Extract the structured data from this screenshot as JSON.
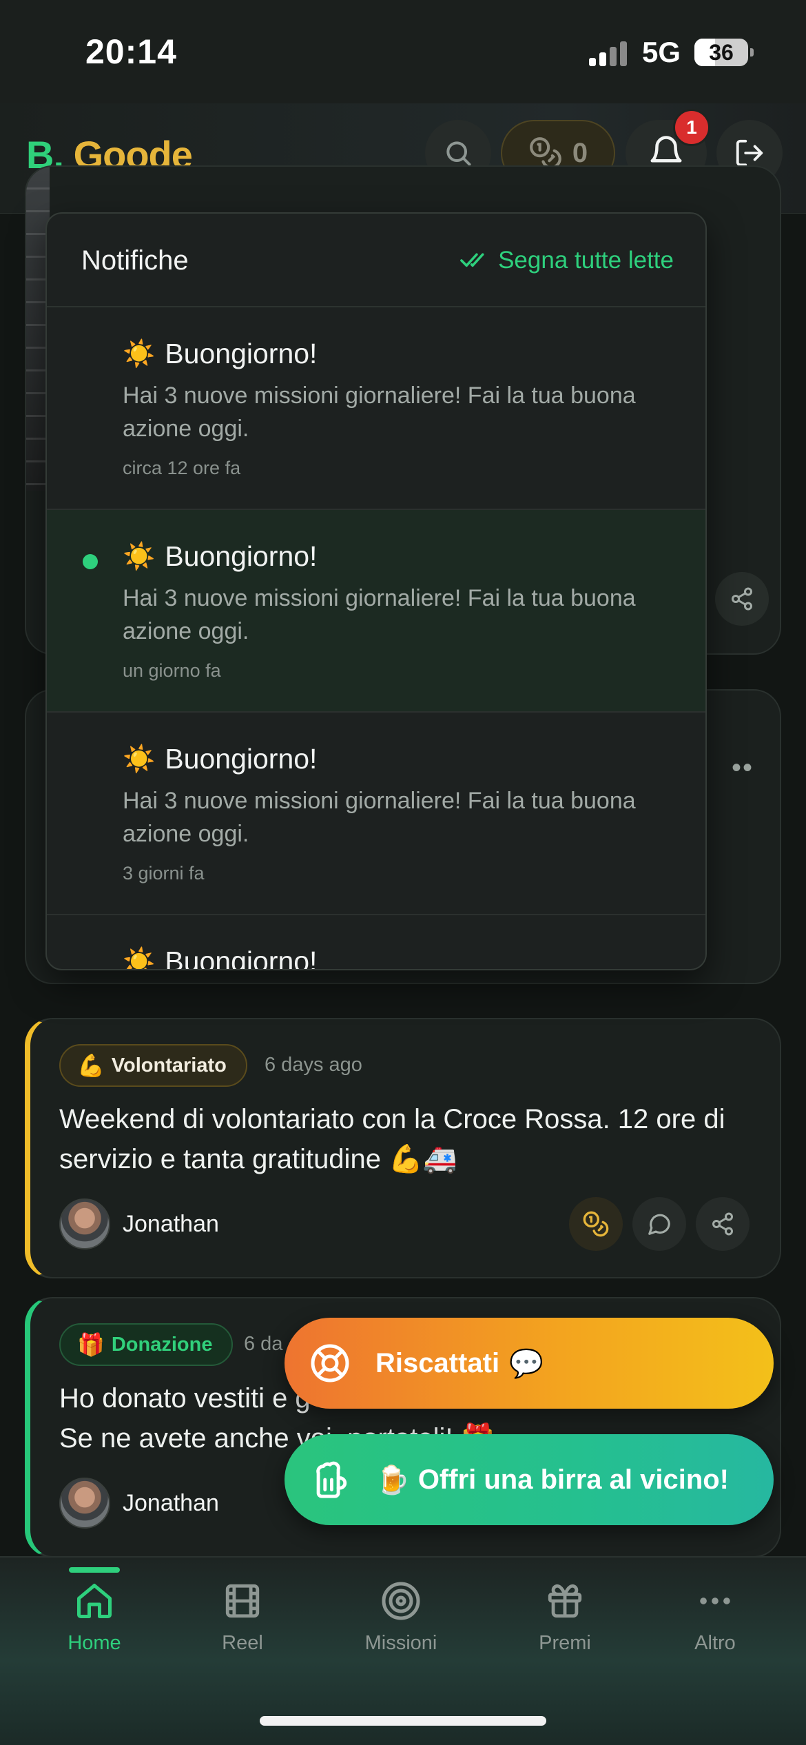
{
  "status_bar": {
    "time": "20:14",
    "network": "5G",
    "battery": "36"
  },
  "header": {
    "logo_b": "B.",
    "logo_name": "Goode",
    "coins": "0",
    "notification_count": "1"
  },
  "notifications": {
    "title": "Notifiche",
    "mark_all_label": "Segna tutte lette",
    "items": [
      {
        "emoji": "☀️",
        "title": "Buongiorno!",
        "body": "Hai 3 nuove missioni giornaliere! Fai la tua buona azione oggi.",
        "time": "circa 12 ore fa",
        "unread": false
      },
      {
        "emoji": "☀️",
        "title": "Buongiorno!",
        "body": "Hai 3 nuove missioni giornaliere! Fai la tua buona azione oggi.",
        "time": "un giorno fa",
        "unread": true
      },
      {
        "emoji": "☀️",
        "title": "Buongiorno!",
        "body": "Hai 3 nuove missioni giornaliere! Fai la tua buona azione oggi.",
        "time": "3 giorni fa",
        "unread": false
      },
      {
        "emoji": "☀️",
        "title": "Buongiorno!"
      }
    ]
  },
  "posts": [
    {
      "category_emoji": "💪",
      "category": "Volontariato",
      "time_ago": "6 days ago",
      "text": "Weekend di volontariato con la Croce Rossa. 12 ore di servizio e tanta gratitudine 💪🚑",
      "author": "Jonathan"
    },
    {
      "category_emoji": "🎁",
      "category": "Donazione",
      "time_ago": "6 da",
      "text": "Ho donato vestiti e g\nSe ne avete anche voi, portateli! 🎁",
      "author": "Jonathan"
    }
  ],
  "fabs": {
    "ransom_label": "Riscattati",
    "ransom_emoji": "💬",
    "beer_label": "Offri una birra al vicino!",
    "beer_emoji": "🍺"
  },
  "bottom_nav": [
    {
      "label": "Home",
      "icon": "home-icon",
      "active": true
    },
    {
      "label": "Reel",
      "icon": "film-icon",
      "active": false
    },
    {
      "label": "Missioni",
      "icon": "target-icon",
      "active": false
    },
    {
      "label": "Premi",
      "icon": "gift-icon",
      "active": false
    },
    {
      "label": "Altro",
      "icon": "more-icon",
      "active": false
    }
  ],
  "colors": {
    "accent_green": "#2ed07d",
    "accent_gold": "#e6b53a",
    "fab_orange": "#ee7430",
    "fab_teal": "#25c08f",
    "badge_red": "#d92d2d"
  }
}
